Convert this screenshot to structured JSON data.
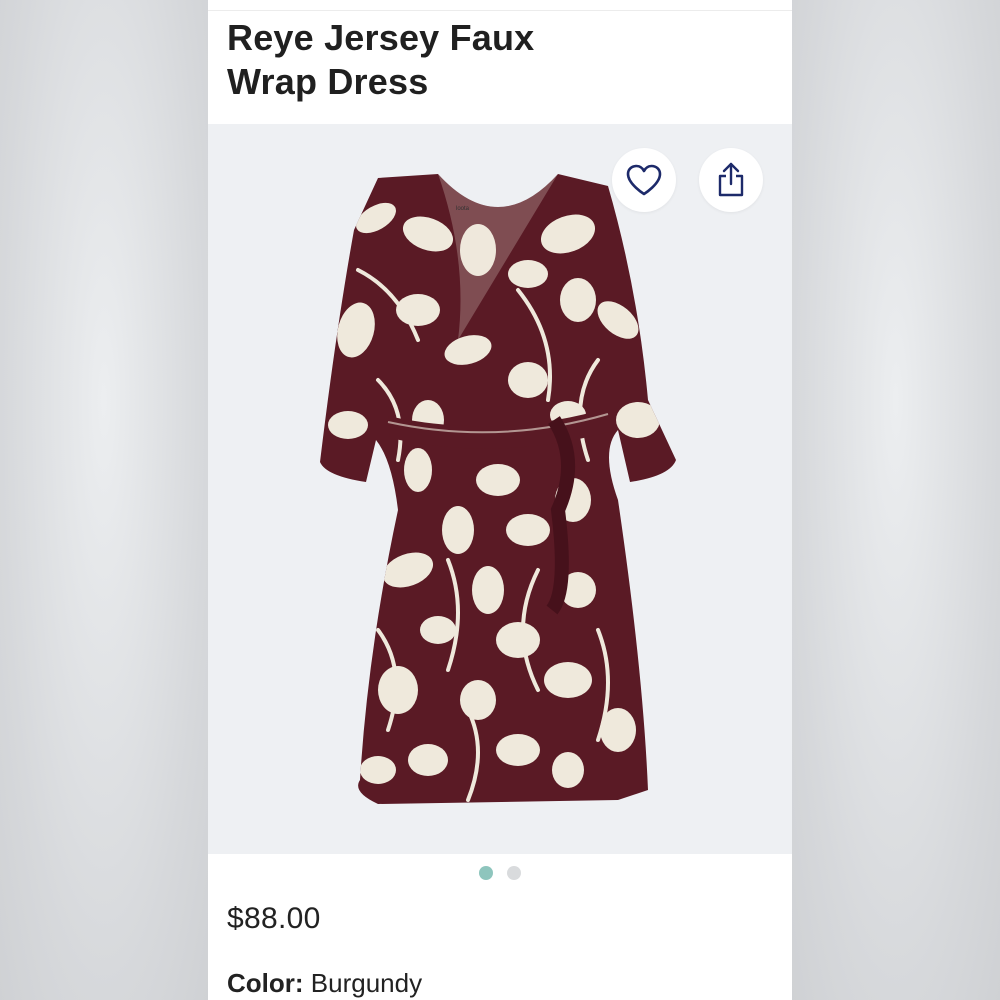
{
  "product": {
    "title_line1": "Reye Jersey Faux",
    "title_line2": "Wrap Dress",
    "price": "$88.00",
    "color_label": "Color:",
    "color_value": "Burgundy",
    "brand_tag": "loota"
  },
  "gallery": {
    "current_index": 1,
    "total_images": 2
  },
  "actions": {
    "favorite_icon": "heart-icon",
    "share_icon": "share-icon"
  },
  "colors": {
    "dress": "#5a1a25",
    "print": "#efe9dc",
    "active_dot": "#8ec5bd",
    "inactive_dot": "#d9dbdd",
    "icon_stroke": "#1d2a6a"
  }
}
